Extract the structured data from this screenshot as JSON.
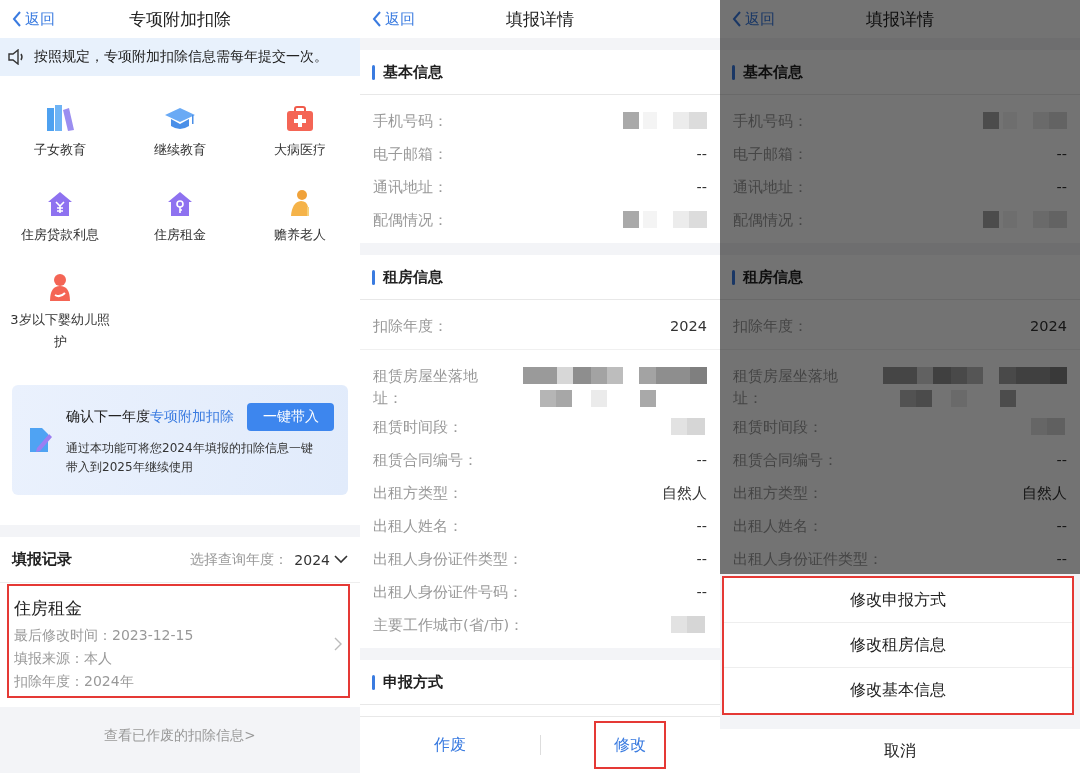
{
  "screens": [
    {
      "kind": "home",
      "nav": {
        "back": "返回",
        "title": "专项附加扣除"
      },
      "notice": "按照规定，专项附加扣除信息需每年提交一次。",
      "categories": [
        {
          "label": "子女教育"
        },
        {
          "label": "继续教育"
        },
        {
          "label": "大病医疗"
        },
        {
          "label": "住房贷款利息"
        },
        {
          "label": "住房租金"
        },
        {
          "label": "赡养老人"
        },
        {
          "label": "3岁以下婴幼儿照护"
        }
      ],
      "banner": {
        "title": "确认下一年度",
        "title_link": "专项附加扣除",
        "button": "一键带入",
        "text": "通过本功能可将您2024年填报的扣除信息一键带入到2025年继续使用"
      },
      "records": {
        "title": "填报记录",
        "filter_label": "选择查询年度：",
        "filter_value": "2024",
        "items": [
          {
            "title": "住房租金",
            "lines": [
              "最后修改时间：2023-12-15",
              "填报来源：本人",
              "扣除年度：2024年"
            ],
            "highlighted": true
          }
        ]
      },
      "footer_link": "查看已作废的扣除信息>"
    },
    {
      "kind": "detail",
      "nav": {
        "back": "返回",
        "title": "填报详情"
      },
      "sections": [
        {
          "title": "基本信息",
          "groups": [
            [
              {
                "label": "手机号码：",
                "kind": "blurred"
              },
              {
                "label": "电子邮箱：",
                "kind": "text",
                "value": "--"
              },
              {
                "label": "通讯地址：",
                "kind": "text",
                "value": "--"
              },
              {
                "label": "配偶情况：",
                "kind": "blurred"
              }
            ]
          ]
        },
        {
          "title": "租房信息",
          "groups": [
            [
              {
                "label": "扣除年度：",
                "kind": "text",
                "value": "2024"
              }
            ],
            [
              {
                "label": "租赁房屋坐落地址：",
                "kind": "blurred_long"
              },
              {
                "label": "租赁时间段：",
                "kind": "blurred_faint"
              },
              {
                "label": "租赁合同编号：",
                "kind": "text",
                "value": "--"
              },
              {
                "label": "出租方类型：",
                "kind": "text",
                "value": "自然人"
              },
              {
                "label": "出租人姓名：",
                "kind": "text",
                "value": "--"
              },
              {
                "label": "出租人身份证件类型：",
                "kind": "text",
                "value": "--"
              },
              {
                "label": "出租人身份证件号码：",
                "kind": "text",
                "value": "--"
              },
              {
                "label": "主要工作城市(省/市)：",
                "kind": "blurred_faint"
              }
            ]
          ]
        },
        {
          "title": "申报方式"
        }
      ],
      "bottom_buttons": [
        {
          "label": "作废",
          "highlighted": false
        },
        {
          "label": "修改",
          "highlighted": true
        }
      ]
    },
    {
      "kind": "detail",
      "dimmed": true,
      "nav": {
        "back": "返回",
        "title": "填报详情"
      },
      "sections": [
        {
          "title": "基本信息",
          "groups": [
            [
              {
                "label": "手机号码：",
                "kind": "blurred"
              },
              {
                "label": "电子邮箱：",
                "kind": "text",
                "value": "--"
              },
              {
                "label": "通讯地址：",
                "kind": "text",
                "value": "--"
              },
              {
                "label": "配偶情况：",
                "kind": "blurred"
              }
            ]
          ]
        },
        {
          "title": "租房信息",
          "groups": [
            [
              {
                "label": "扣除年度：",
                "kind": "text",
                "value": "2024"
              }
            ],
            [
              {
                "label": "租赁房屋坐落地址：",
                "kind": "blurred_long"
              },
              {
                "label": "租赁时间段：",
                "kind": "blurred_faint"
              },
              {
                "label": "租赁合同编号：",
                "kind": "text",
                "value": "--"
              },
              {
                "label": "出租方类型：",
                "kind": "text",
                "value": "自然人"
              },
              {
                "label": "出租人姓名：",
                "kind": "text",
                "value": "--"
              },
              {
                "label": "出租人身份证件类型：",
                "kind": "text",
                "value": "--"
              }
            ]
          ]
        }
      ],
      "sheet": {
        "options": [
          "修改申报方式",
          "修改租房信息",
          "修改基本信息"
        ],
        "highlighted": true,
        "cancel": "取消"
      }
    }
  ]
}
